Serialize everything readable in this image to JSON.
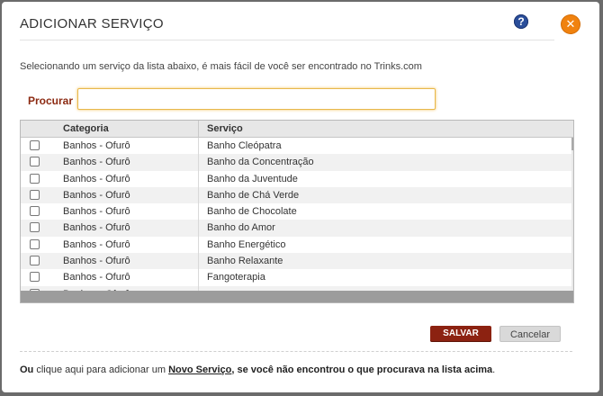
{
  "dialog": {
    "title": "ADICIONAR SERVIÇO",
    "help_icon": "question-mark-icon",
    "help_glyph": "?",
    "close_icon": "close-icon",
    "close_glyph": "✕",
    "intro": "Selecionando um serviço da lista abaixo, é mais fácil de você ser encontrado no Trinks.com"
  },
  "search": {
    "label": "Procurar",
    "value": "",
    "placeholder": ""
  },
  "grid": {
    "columns": [
      "Categoria",
      "Serviço"
    ],
    "rows": [
      {
        "checked": false,
        "category": "Banhos - Ofurô",
        "service": "Banho Cleópatra"
      },
      {
        "checked": false,
        "category": "Banhos - Ofurô",
        "service": "Banho da Concentração"
      },
      {
        "checked": false,
        "category": "Banhos - Ofurô",
        "service": "Banho da Juventude"
      },
      {
        "checked": false,
        "category": "Banhos - Ofurô",
        "service": "Banho de Chá Verde"
      },
      {
        "checked": false,
        "category": "Banhos - Ofurô",
        "service": "Banho de Chocolate"
      },
      {
        "checked": false,
        "category": "Banhos - Ofurô",
        "service": "Banho do Amor"
      },
      {
        "checked": false,
        "category": "Banhos - Ofurô",
        "service": "Banho Energético"
      },
      {
        "checked": false,
        "category": "Banhos - Ofurô",
        "service": "Banho Relaxante"
      },
      {
        "checked": false,
        "category": "Banhos - Ofurô",
        "service": "Fangoterapia"
      },
      {
        "checked": false,
        "category": "Banhos - Ofurô",
        "service": ""
      }
    ]
  },
  "actions": {
    "save_label": "SALVAR",
    "cancel_label": "Cancelar"
  },
  "footer": {
    "ou": "Ou",
    "text1": " clique aqui para adicionar um ",
    "link": "Novo Serviço",
    "text2": ", se você não encontrou o que procurava na lista acima",
    "period": "."
  },
  "colors": {
    "accent": "#8c2211",
    "search_label": "#8c2a12",
    "close": "#f0820f",
    "help": "#2a4e9a"
  }
}
